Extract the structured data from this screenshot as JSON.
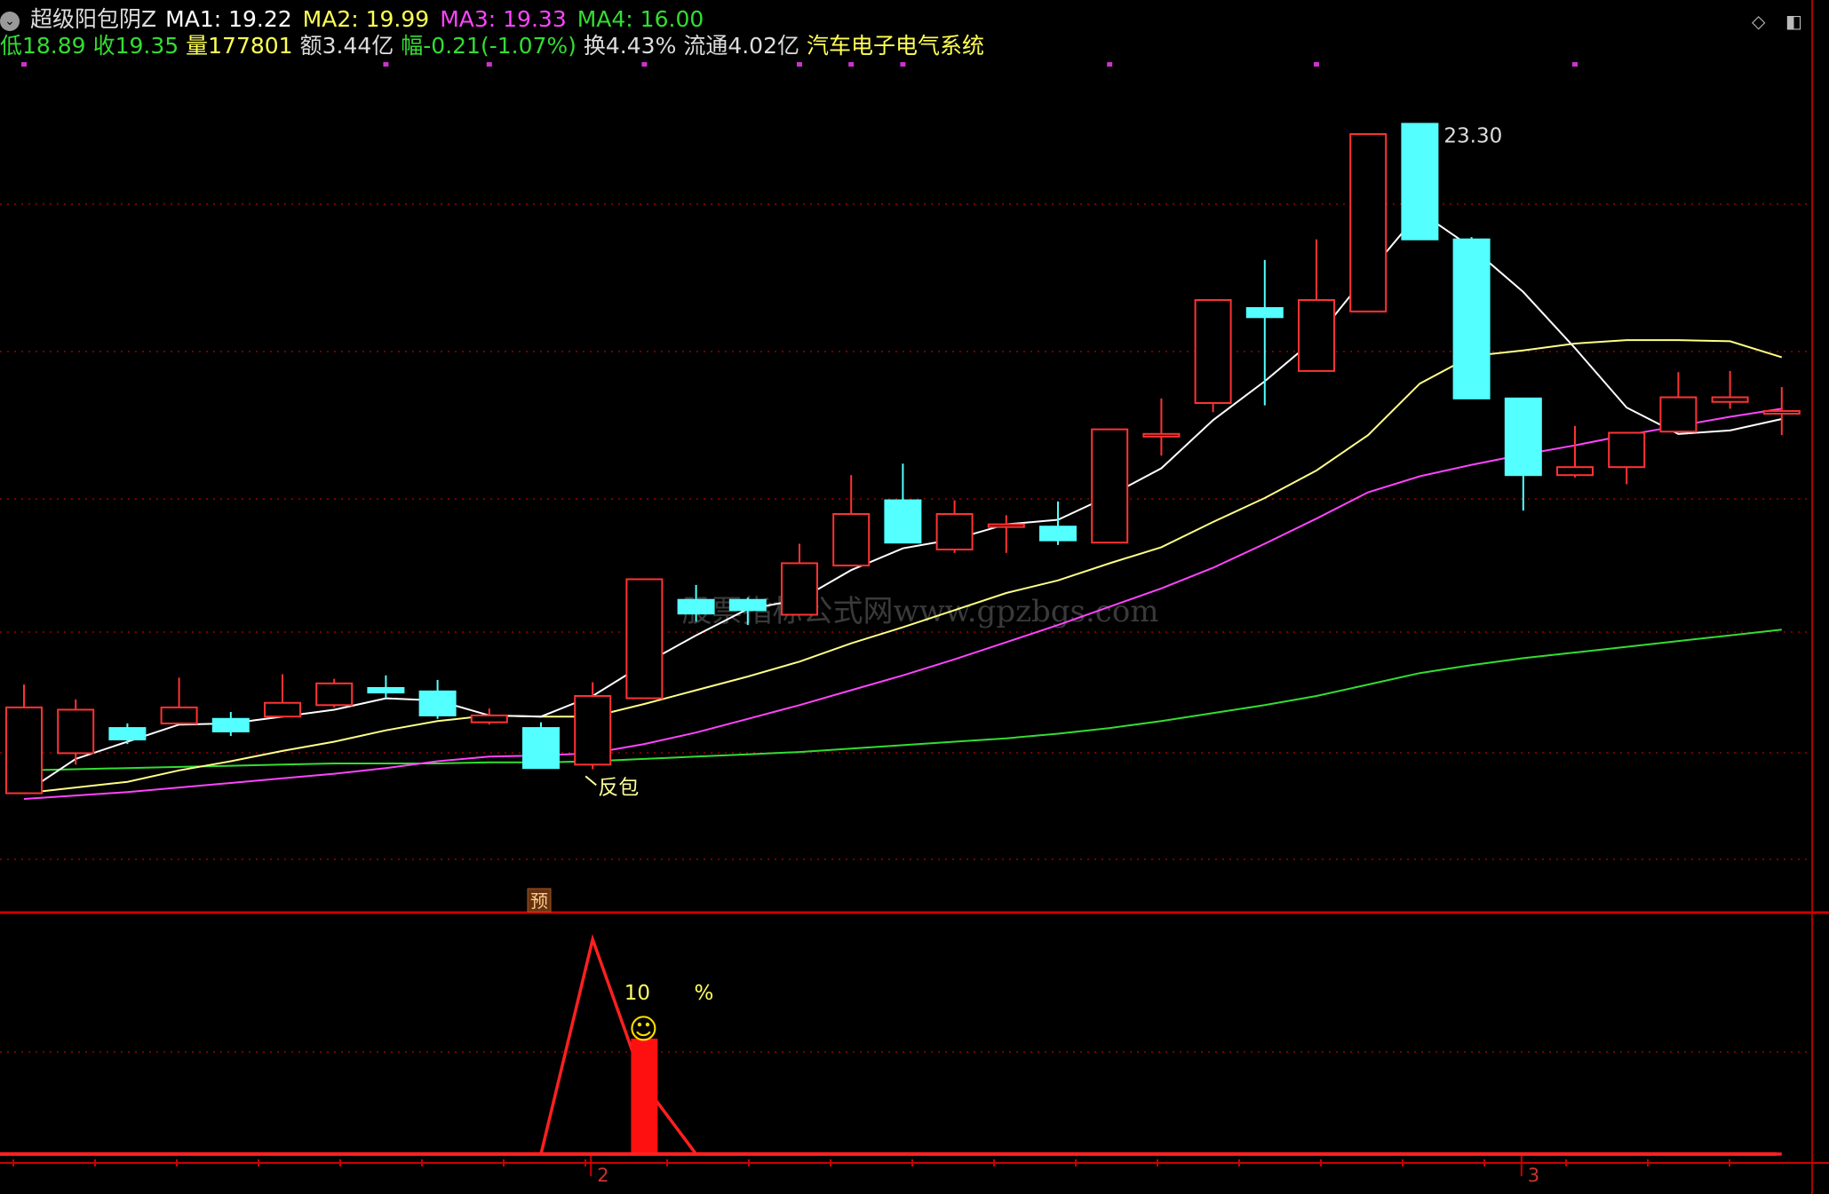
{
  "header": {
    "indicator_name": "超级阳包阴Z",
    "ma": [
      {
        "label": "MA1: 19.22",
        "color": "#ffffff"
      },
      {
        "label": "MA2: 19.99",
        "color": "#ffff55"
      },
      {
        "label": "MA3: 19.33",
        "color": "#ff44ff"
      },
      {
        "label": "MA4: 16.00",
        "color": "#33dd33"
      }
    ],
    "info": [
      {
        "text": "低18.89",
        "color": "#33dd33"
      },
      {
        "text": "收19.35",
        "color": "#33dd33"
      },
      {
        "text": "量177801",
        "color": "#ffff55"
      },
      {
        "text": "额3.44亿",
        "color": "#dddddd"
      },
      {
        "text": "幅-0.21(-1.07%)",
        "color": "#33dd33"
      },
      {
        "text": "换4.43%",
        "color": "#dddddd"
      },
      {
        "text": "流通4.02亿",
        "color": "#dddddd"
      },
      {
        "text": "汽车电子电气系统",
        "color": "#ffff55"
      }
    ]
  },
  "icons": {
    "diamond": "◇",
    "window": "◧",
    "dropdown": "⌄"
  },
  "watermark": "股票指标公式网www.gpzbgs.com",
  "colors": {
    "up": "#ff3333",
    "down": "#54ffff",
    "ma1": "#ffffff",
    "ma2": "#ffff88",
    "ma3": "#ff44ff",
    "ma4": "#33dd33",
    "grid": "#990000",
    "marker": "#cc33cc"
  },
  "chart_data": [
    {
      "type": "candlestick",
      "price_range": [
        17.1,
        23.5
      ],
      "high_label": "23.30",
      "annotation": "反包",
      "flag_label": "预",
      "x_axis_labels": [
        "2",
        "3"
      ],
      "candles": [
        {
          "o": 17.15,
          "c": 17.9,
          "h": 18.1,
          "l": 17.15
        },
        {
          "o": 17.5,
          "c": 17.88,
          "h": 17.97,
          "l": 17.4
        },
        {
          "o": 17.72,
          "c": 17.62,
          "h": 17.76,
          "l": 17.58
        },
        {
          "o": 17.76,
          "c": 17.9,
          "h": 18.16,
          "l": 17.76
        },
        {
          "o": 17.8,
          "c": 17.69,
          "h": 17.86,
          "l": 17.65
        },
        {
          "o": 17.82,
          "c": 17.94,
          "h": 18.19,
          "l": 17.82
        },
        {
          "o": 17.92,
          "c": 18.11,
          "h": 18.15,
          "l": 17.9
        },
        {
          "o": 18.07,
          "c": 18.03,
          "h": 18.18,
          "l": 17.98
        },
        {
          "o": 18.04,
          "c": 17.83,
          "h": 18.14,
          "l": 17.8
        },
        {
          "o": 17.77,
          "c": 17.83,
          "h": 17.89,
          "l": 17.75
        },
        {
          "o": 17.72,
          "c": 17.37,
          "h": 17.77,
          "l": 17.37
        },
        {
          "o": 17.4,
          "c": 18.0,
          "h": 18.12,
          "l": 17.36
        },
        {
          "o": 17.98,
          "c": 19.02,
          "h": 19.02,
          "l": 17.98
        },
        {
          "o": 18.84,
          "c": 18.72,
          "h": 18.97,
          "l": 18.65
        },
        {
          "o": 18.84,
          "c": 18.75,
          "h": 18.86,
          "l": 18.62
        },
        {
          "o": 18.71,
          "c": 19.16,
          "h": 19.33,
          "l": 18.71
        },
        {
          "o": 19.14,
          "c": 19.59,
          "h": 19.93,
          "l": 19.14
        },
        {
          "o": 19.71,
          "c": 19.34,
          "h": 20.03,
          "l": 19.34
        },
        {
          "o": 19.28,
          "c": 19.59,
          "h": 19.71,
          "l": 19.25
        },
        {
          "o": 19.48,
          "c": 19.5,
          "h": 19.58,
          "l": 19.25
        },
        {
          "o": 19.48,
          "c": 19.36,
          "h": 19.7,
          "l": 19.32
        },
        {
          "o": 19.34,
          "c": 20.33,
          "h": 20.33,
          "l": 19.34
        },
        {
          "o": 20.27,
          "c": 20.29,
          "h": 20.6,
          "l": 20.1
        },
        {
          "o": 20.56,
          "c": 21.46,
          "h": 21.46,
          "l": 20.48
        },
        {
          "o": 21.39,
          "c": 21.31,
          "h": 21.81,
          "l": 20.54
        },
        {
          "o": 20.84,
          "c": 21.46,
          "h": 21.99,
          "l": 20.84
        },
        {
          "o": 21.36,
          "c": 22.91,
          "h": 22.91,
          "l": 21.36
        },
        {
          "o": 23.0,
          "c": 21.99,
          "h": 23.0,
          "l": 21.99
        },
        {
          "o": 21.99,
          "c": 20.6,
          "h": 22.01,
          "l": 20.6
        },
        {
          "o": 20.6,
          "c": 19.93,
          "h": 20.6,
          "l": 19.62
        },
        {
          "o": 19.93,
          "c": 20.0,
          "h": 20.36,
          "l": 19.91
        },
        {
          "o": 20.0,
          "c": 20.3,
          "h": 20.3,
          "l": 19.85
        },
        {
          "o": 20.31,
          "c": 20.61,
          "h": 20.83,
          "l": 20.31
        },
        {
          "o": 20.57,
          "c": 20.61,
          "h": 20.84,
          "l": 20.51
        },
        {
          "o": 20.49,
          "c": 20.49,
          "h": 20.7,
          "l": 20.28
        }
      ],
      "ma1": [
        17.15,
        17.45,
        17.6,
        17.75,
        17.76,
        17.82,
        17.88,
        17.98,
        17.96,
        17.83,
        17.82,
        18.0,
        18.28,
        18.53,
        18.76,
        18.84,
        19.1,
        19.29,
        19.37,
        19.5,
        19.54,
        19.75,
        19.99,
        20.41,
        20.75,
        21.13,
        21.69,
        22.23,
        21.92,
        21.53,
        21.04,
        20.52,
        20.29,
        20.32,
        20.42
      ],
      "ma2": [
        17.15,
        17.2,
        17.25,
        17.35,
        17.43,
        17.52,
        17.6,
        17.7,
        17.78,
        17.83,
        17.82,
        17.82,
        17.93,
        18.05,
        18.17,
        18.3,
        18.46,
        18.6,
        18.75,
        18.9,
        19.01,
        19.16,
        19.3,
        19.52,
        19.73,
        19.97,
        20.28,
        20.73,
        20.97,
        21.02,
        21.08,
        21.11,
        21.11,
        21.1,
        20.96
      ],
      "ma3": [
        17.1,
        17.13,
        17.16,
        17.2,
        17.24,
        17.28,
        17.32,
        17.37,
        17.43,
        17.47,
        17.48,
        17.5,
        17.58,
        17.68,
        17.8,
        17.92,
        18.05,
        18.18,
        18.32,
        18.47,
        18.62,
        18.78,
        18.94,
        19.12,
        19.33,
        19.55,
        19.78,
        19.92,
        20.02,
        20.11,
        20.19,
        20.28,
        20.36,
        20.44,
        20.51
      ],
      "ma4": [
        17.35,
        17.36,
        17.37,
        17.38,
        17.39,
        17.4,
        17.41,
        17.41,
        17.41,
        17.42,
        17.42,
        17.43,
        17.45,
        17.47,
        17.49,
        17.51,
        17.54,
        17.57,
        17.6,
        17.63,
        17.67,
        17.72,
        17.78,
        17.85,
        17.92,
        18.0,
        18.1,
        18.2,
        18.27,
        18.33,
        18.38,
        18.43,
        18.48,
        18.53,
        18.58
      ]
    },
    {
      "type": "line",
      "label_value": "10",
      "label_unit": "%",
      "face_icon": "☺",
      "range": [
        0,
        20
      ],
      "line": [
        0,
        0,
        0,
        0,
        0,
        0,
        0,
        0,
        0,
        0,
        0,
        18.6,
        6.0,
        0,
        0,
        0,
        0,
        0,
        0,
        0,
        0,
        0,
        0,
        0,
        0,
        0,
        0,
        0,
        0,
        0,
        0,
        0,
        0,
        0,
        0
      ],
      "bar": {
        "index": 12,
        "value": 10
      }
    }
  ]
}
